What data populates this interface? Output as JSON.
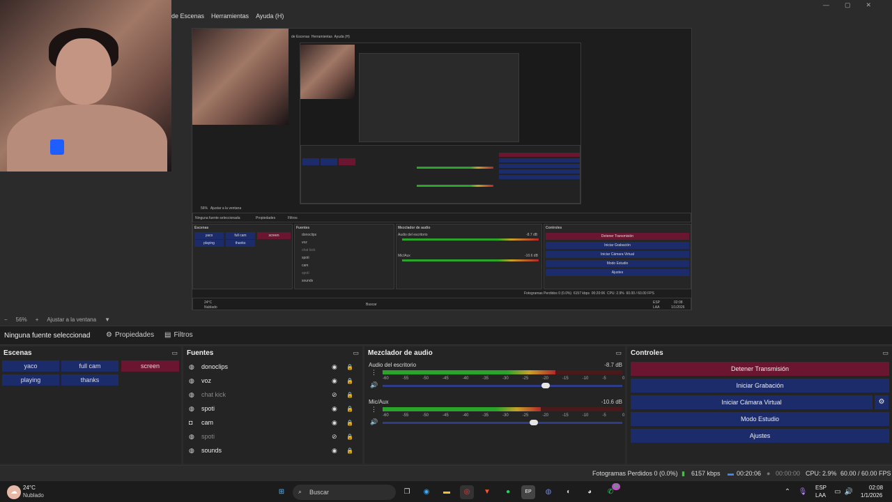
{
  "menu": [
    "de Escenas",
    "Herramientas",
    "Ayuda (H)"
  ],
  "window_controls": [
    "—",
    "▢",
    "✕"
  ],
  "zoom": {
    "value": "56%",
    "fit": "Ajustar a la ventana",
    "minus": "−",
    "plus": "+",
    "dropdown": "▼"
  },
  "context": {
    "label": "Ninguna fuente seleccionad",
    "properties": "Propiedades",
    "filters": "Filtros"
  },
  "scenes": {
    "title": "Escenas",
    "items": [
      {
        "label": "yaco"
      },
      {
        "label": "full cam"
      },
      {
        "label": "screen",
        "active": true
      },
      {
        "label": "playing"
      },
      {
        "label": "thanks"
      }
    ]
  },
  "sources": {
    "title": "Fuentes",
    "items": [
      {
        "name": "donoclips",
        "icon": "globe-icon",
        "visible": true,
        "locked": true
      },
      {
        "name": "voz",
        "icon": "globe-icon",
        "visible": true,
        "locked": true
      },
      {
        "name": "chat kick",
        "icon": "globe-icon",
        "visible": false,
        "locked": true
      },
      {
        "name": "spoti",
        "icon": "globe-icon",
        "visible": true,
        "locked": true
      },
      {
        "name": "cam",
        "icon": "camera-icon",
        "visible": true,
        "locked": true
      },
      {
        "name": "spoti",
        "icon": "globe-icon",
        "visible": false,
        "locked": true
      },
      {
        "name": "sounds",
        "icon": "globe-icon",
        "visible": true,
        "locked": true
      }
    ]
  },
  "mixer": {
    "title": "Mezclador de audio",
    "ticks": [
      "-60",
      "-55",
      "-50",
      "-45",
      "-40",
      "-35",
      "-30",
      "-25",
      "-20",
      "-15",
      "-10",
      "-5",
      "0"
    ],
    "channels": [
      {
        "name": "Audio del escritorio",
        "db": "-8.7 dB",
        "level": 0.72,
        "volume": 0.68
      },
      {
        "name": "Mic/Aux",
        "db": "-10.6 dB",
        "level": 0.66,
        "volume": 0.63
      }
    ]
  },
  "controls": {
    "title": "Controles",
    "buttons": [
      "Detener Transmisión",
      "Iniciar Grabación",
      "Iniciar Cámara Virtual",
      "Modo Estudio",
      "Ajustes"
    ]
  },
  "status": {
    "dropped": "Fotogramas Perdidos 0 (0.0%)",
    "bitrate": "6157 kbps",
    "stream_time": "00:20:06",
    "rec_time": "00:00:00",
    "cpu": "CPU: 2.9%",
    "fps": "60.00 / 60.00 FPS"
  },
  "taskbar": {
    "weather_temp": "24°C",
    "weather_desc": "Nublado",
    "search": "Buscar",
    "lang": "ESP",
    "layout": "LAA",
    "time": "02:08",
    "date": "1/1/2026",
    "badge": "10"
  },
  "preview_text": {
    "menu": [
      "de Escenas",
      "Herramientas",
      "Ayuda (H)"
    ],
    "context": "Ninguna fuente seleccionada",
    "scenes_title": "Escenas",
    "sources_title": "Fuentes",
    "mixer_title": "Mezclador de audio",
    "controls_title": "Controles",
    "zoom": "56%",
    "fit": "Ajustar a la ventana",
    "properties": "Propiedades",
    "filters": "Filtros",
    "mix_ch1": "Audio del escritorio",
    "mix_ch2": "Mic/Aux",
    "mix_db1": "-8.7 dB",
    "mix_db2": "-10.6 dB",
    "status": "Fotogramas Perdidos 0 (0.0%)",
    "bitrate": "6157 kbps",
    "time": "00:20:06",
    "cpu": "CPU: 2.9%",
    "fps": "60.00 / 60.00 FPS",
    "weather_temp": "24°C",
    "weather": "Nublado",
    "search": "Buscar",
    "clock": "02:08",
    "date": "1/1/2026",
    "lang": "ESP",
    "layout": "LAA",
    "sources": [
      "donoclips",
      "voz",
      "chat kick",
      "spoti",
      "cam",
      "spoti",
      "sounds"
    ],
    "scenes": [
      "yaco",
      "full cam",
      "screen",
      "playing",
      "thanks"
    ],
    "controls": [
      "Detener Transmisión",
      "Iniciar Grabación",
      "Iniciar Cámara Virtual",
      "Modo Estudio",
      "Ajustes"
    ]
  }
}
